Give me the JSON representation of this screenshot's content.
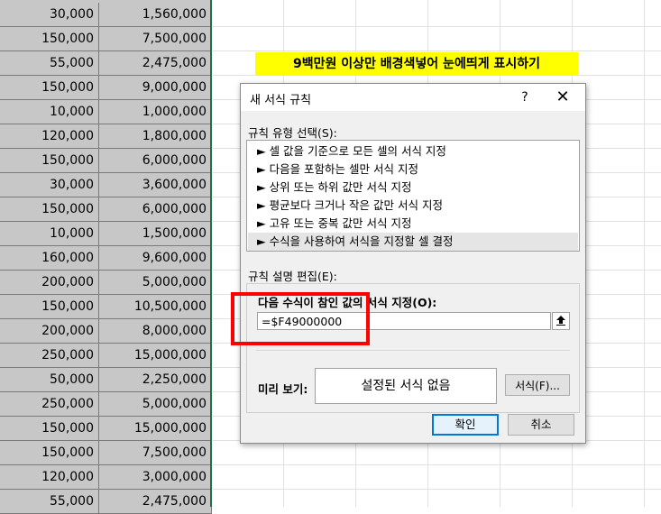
{
  "sheet": {
    "rows": [
      [
        "30,000",
        "1,560,000"
      ],
      [
        "150,000",
        "7,500,000"
      ],
      [
        "55,000",
        "2,475,000"
      ],
      [
        "150,000",
        "9,000,000"
      ],
      [
        "10,000",
        "1,000,000"
      ],
      [
        "120,000",
        "1,800,000"
      ],
      [
        "150,000",
        "6,000,000"
      ],
      [
        "30,000",
        "3,600,000"
      ],
      [
        "150,000",
        "6,000,000"
      ],
      [
        "10,000",
        "1,500,000"
      ],
      [
        "160,000",
        "9,600,000"
      ],
      [
        "200,000",
        "5,000,000"
      ],
      [
        "150,000",
        "10,500,000"
      ],
      [
        "200,000",
        "8,000,000"
      ],
      [
        "250,000",
        "15,000,000"
      ],
      [
        "50,000",
        "2,250,000"
      ],
      [
        "250,000",
        "5,000,000"
      ],
      [
        "150,000",
        "15,000,000"
      ],
      [
        "150,000",
        "7,500,000"
      ],
      [
        "120,000",
        "3,000,000"
      ],
      [
        "55,000",
        "2,475,000"
      ]
    ]
  },
  "banner": "9백만원 이상만 배경색넣어 눈에띄게 표시하기",
  "dialog": {
    "title": "새 서식 규칙",
    "help": "?",
    "close": "✕",
    "type_label": "규칙 유형 선택(S):",
    "rule_types": [
      "► 셀 값을 기준으로 모든 셀의 서식 지정",
      "► 다음을 포함하는 셀만 서식 지정",
      "► 상위 또는 하위 값만 서식 지정",
      "► 평균보다 크거나 작은 값만 서식 지정",
      "► 고유 또는 중복 값만 서식 지정",
      "► 수식을 사용하여 서식을 지정할 셀 결정"
    ],
    "selected_index": 5,
    "edit_label": "규칙 설명 편집(E):",
    "formula_label": "다음 수식이 참인 값의 서식 지정(O):",
    "formula_value": "=$F49000000",
    "preview_label": "미리 보기:",
    "preview_text": "설정된 서식 없음",
    "format_button": "서식(F)...",
    "ok_button": "확인",
    "cancel_button": "취소"
  },
  "colors": {
    "cell_fill": "#c7c7c7",
    "banner_fill": "#ffff00",
    "highlight": "#ff0000",
    "selection_edge": "#1e7145"
  }
}
